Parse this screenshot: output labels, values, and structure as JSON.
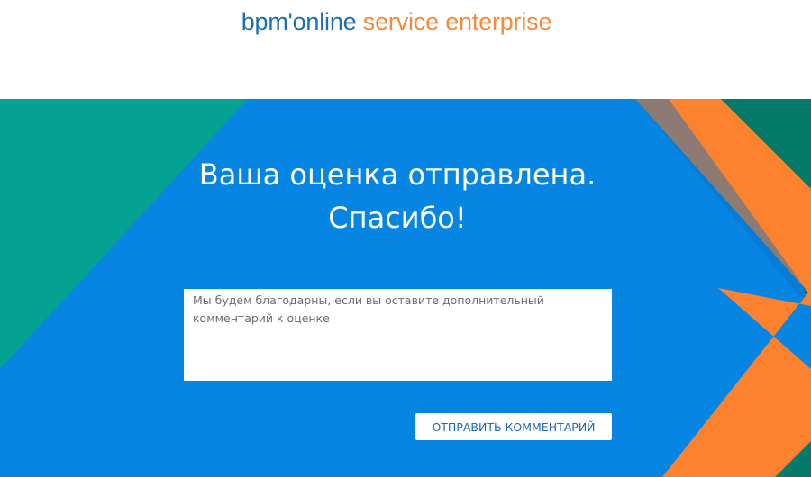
{
  "header": {
    "logo": {
      "brand": "bpm'online",
      "product": "service enterprise"
    }
  },
  "main": {
    "title_line1": "Ваша оценка отправлена.",
    "title_line2": "Спасибо!",
    "comment": {
      "value": "",
      "placeholder": "Мы будем благодарны, если вы оставите дополнительный комментарий к оценке"
    },
    "submit_label": "ОТПРАВИТЬ КОММЕНТАРИЙ"
  },
  "colors": {
    "background_blue": "#0685e3",
    "teal": "#05a192",
    "dark_teal": "#047a6a",
    "orange": "#fd8230",
    "brand_blue": "#1a6eb3",
    "brand_orange": "#f6893b"
  }
}
